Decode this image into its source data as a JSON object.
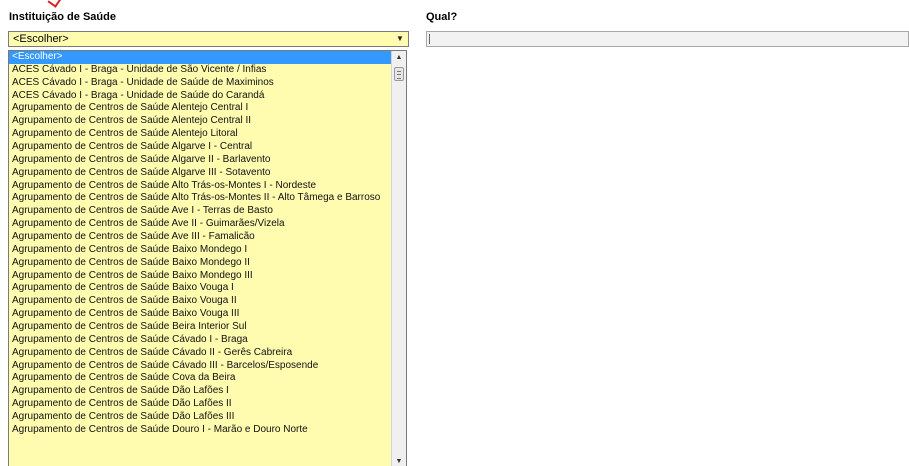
{
  "form": {
    "instituicao_label": "Instituição de Saúde",
    "qual_label": "Qual?",
    "select_value": "<Escolher>",
    "qual_value": ""
  },
  "dropdown": {
    "options": [
      "<Escolher>",
      "ACES Cávado I - Braga - Unidade de São Vicente / Infias",
      "ACES Cávado I - Braga - Unidade de Saúde de Maximinos",
      "ACES Cávado I - Braga - Unidade de Saúde do Carandá",
      "Agrupamento de Centros de Saúde Alentejo Central I",
      "Agrupamento de Centros de Saúde Alentejo Central II",
      "Agrupamento de Centros de Saúde Alentejo Litoral",
      "Agrupamento de Centros de Saúde Algarve I - Central",
      "Agrupamento de Centros de Saúde Algarve II - Barlavento",
      "Agrupamento de Centros de Saúde Algarve III - Sotavento",
      "Agrupamento de Centros de Saúde Alto Trás-os-Montes I - Nordeste",
      "Agrupamento de Centros de Saúde Alto Trás-os-Montes II - Alto Tâmega e Barroso",
      "Agrupamento de Centros de Saúde Ave I - Terras de Basto",
      "Agrupamento de Centros de Saúde Ave II - Guimarães/Vizela",
      "Agrupamento de Centros de Saúde Ave III - Famalicão",
      "Agrupamento de Centros de Saúde Baixo Mondego I",
      "Agrupamento de Centros de Saúde Baixo Mondego II",
      "Agrupamento de Centros de Saúde Baixo Mondego III",
      "Agrupamento de Centros de Saúde Baixo Vouga I",
      "Agrupamento de Centros de Saúde Baixo Vouga II",
      "Agrupamento de Centros de Saúde Baixo Vouga III",
      "Agrupamento de Centros de Saúde Beira Interior Sul",
      "Agrupamento de Centros de Saúde Cávado I - Braga",
      "Agrupamento de Centros de Saúde Cávado II - Gerês Cabreira",
      "Agrupamento de Centros de Saúde Cávado III - Barcelos/Esposende",
      "Agrupamento de Centros de Saúde Cova da Beira",
      "Agrupamento de Centros de Saúde Dão Lafões I",
      "Agrupamento de Centros de Saúde Dão Lafões II",
      "Agrupamento de Centros de Saúde Dão Lafões III",
      "Agrupamento de Centros de Saúde Douro I - Marão e Douro Norte"
    ],
    "selected_index": 0
  },
  "icons": {
    "select_arrow": "chevron-down-icon",
    "scroll_up": "scroll-up-icon",
    "scroll_down": "scroll-down-icon"
  },
  "colors": {
    "field_bg": "#fffcb0",
    "selected_bg": "#3399ff",
    "annotation": "#e02020"
  }
}
